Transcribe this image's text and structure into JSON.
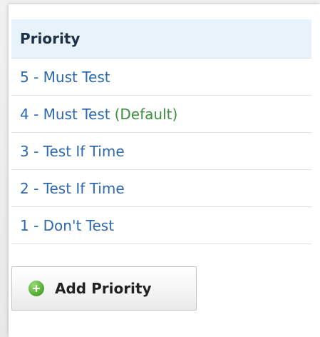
{
  "priority_table": {
    "header": "Priority",
    "rows": [
      {
        "label": "5 - Must Test",
        "suffix": ""
      },
      {
        "label": "4 - Must Test",
        "suffix": "(Default)"
      },
      {
        "label": "3 - Test If Time",
        "suffix": ""
      },
      {
        "label": "2 - Test If Time",
        "suffix": ""
      },
      {
        "label": "1 - Don't Test",
        "suffix": ""
      }
    ]
  },
  "add_button": {
    "label": "Add Priority",
    "icon": "plus-circle-icon"
  },
  "colors": {
    "link": "#2c68b0",
    "default_tag": "#3d8f3d",
    "header_bg": "#e8f2fb",
    "icon_green": "#5bb33a"
  }
}
